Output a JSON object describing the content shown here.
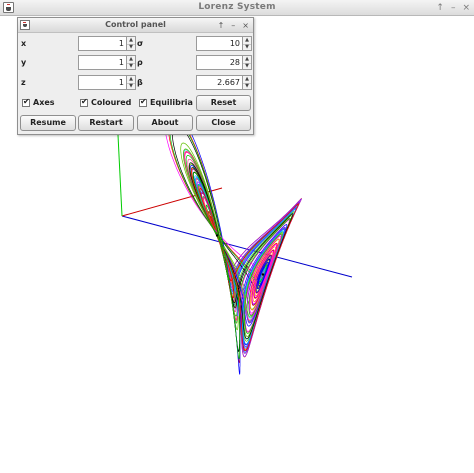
{
  "window": {
    "title": "Lorenz System",
    "controls": [
      "↑",
      "–",
      "×"
    ]
  },
  "panel": {
    "title": "Control panel",
    "controls": [
      "↑",
      "–",
      "×"
    ],
    "fields": {
      "x": {
        "label": "x",
        "value": "1"
      },
      "y": {
        "label": "y",
        "value": "1"
      },
      "z": {
        "label": "z",
        "value": "1"
      },
      "sigma": {
        "label": "σ",
        "value": "10"
      },
      "rho": {
        "label": "ρ",
        "value": "28"
      },
      "beta": {
        "label": "β",
        "value": "2.667"
      }
    },
    "checkboxes": {
      "axes": {
        "label": "Axes",
        "checked": true
      },
      "coloured": {
        "label": "Coloured",
        "checked": true
      },
      "equilibria": {
        "label": "Equilibria",
        "checked": true
      }
    },
    "buttons": {
      "reset": "Reset",
      "resume": "Resume",
      "restart": "Restart",
      "about": "About",
      "close": "Close"
    },
    "spinner_up": "▲",
    "spinner_down": "▼"
  },
  "plot": {
    "trajectory_colors": [
      "#ff0000",
      "#00c000",
      "#0000ff",
      "#ff00ff",
      "#00c8c8",
      "#e0c000",
      "#ff8800",
      "#8800ff",
      "#ff3399",
      "#00a0ff",
      "#60c000",
      "#000000"
    ],
    "axis_colors": {
      "x_axis": "#0000cc",
      "y_axis": "#cc0000",
      "z_axis": "#00cc00"
    }
  }
}
